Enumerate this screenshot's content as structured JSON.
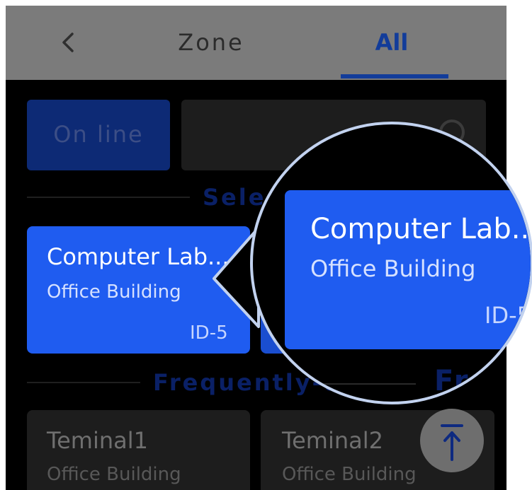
{
  "header": {
    "back_icon": "chevron-left-icon",
    "tabs": [
      {
        "label": "Zone",
        "active": false
      },
      {
        "label": "All",
        "active": true
      }
    ],
    "accent_color": "#123c9a"
  },
  "filters": {
    "online_label": "On line",
    "search_icon": "search-icon"
  },
  "sections": {
    "selected_title": "Selected",
    "frequent_title": "Frequently-used",
    "frequent_title_zoom": "Fre"
  },
  "selected_card": {
    "title": "Computer Lab...",
    "subtitle": "Office Building",
    "id": "ID-5",
    "color": "#1f5cf0"
  },
  "frequent_cards": [
    {
      "title": "Teminal1",
      "subtitle": "Office Building"
    },
    {
      "title": "Teminal2",
      "subtitle": "Office Building"
    }
  ],
  "scroll_top_icon": "arrow-up-to-top-icon"
}
